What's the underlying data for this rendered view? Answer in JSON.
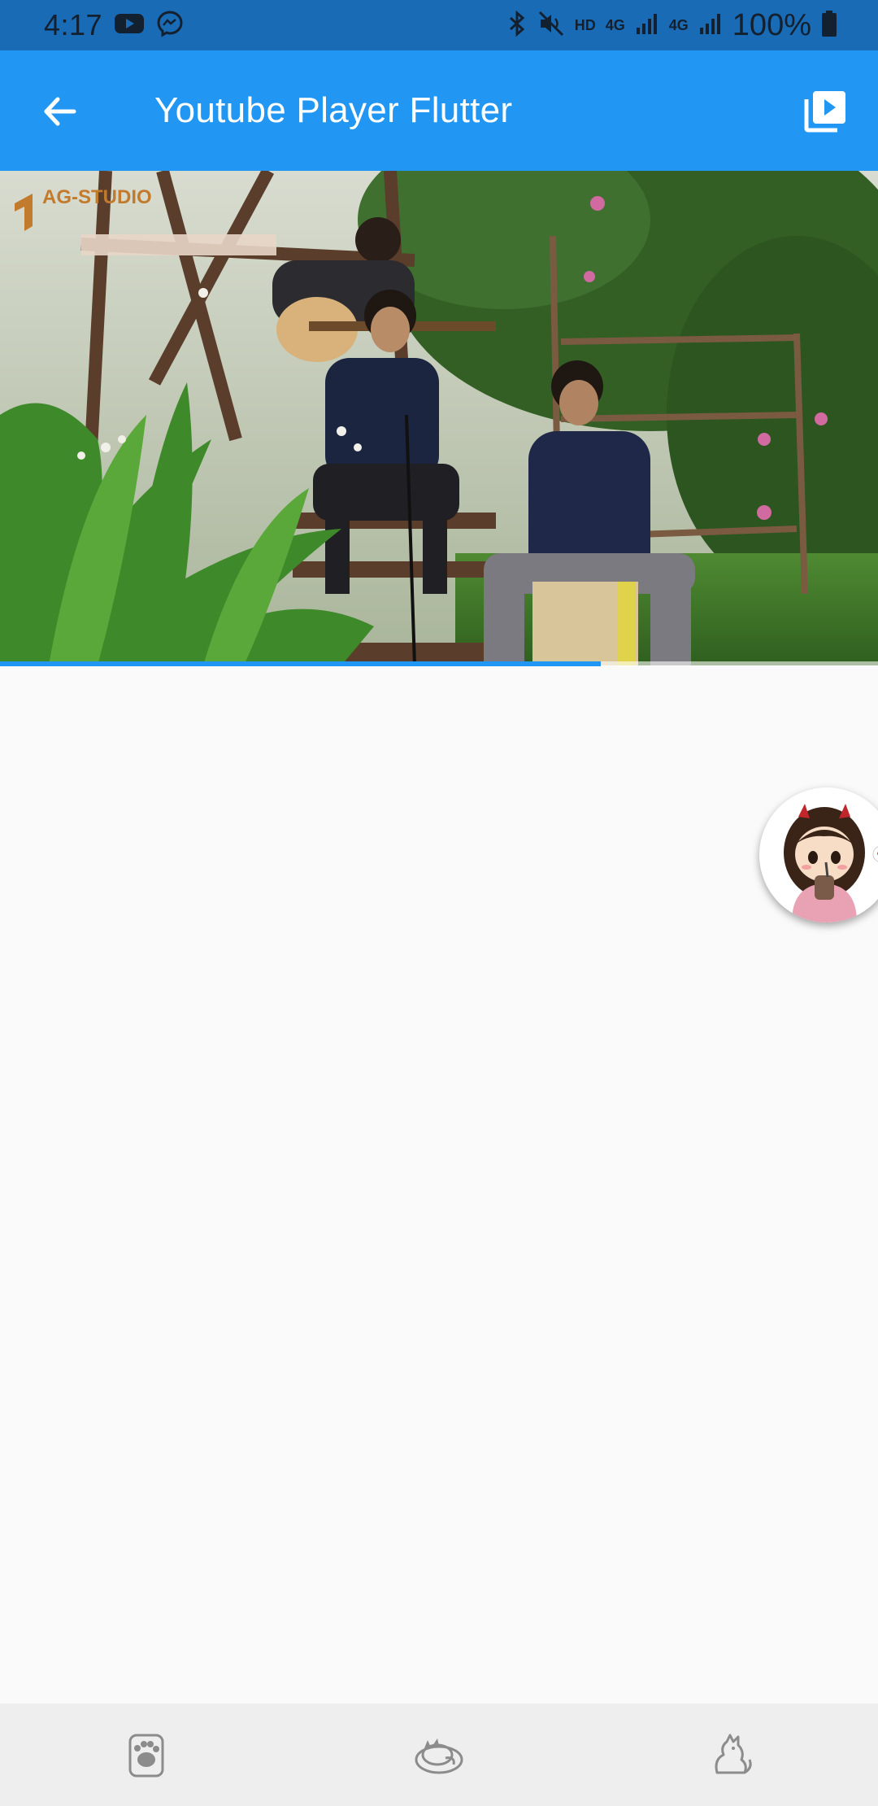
{
  "status_bar": {
    "time": "4:17",
    "network_hd": "HD",
    "network_4g_1": "4G",
    "network_4g_2": "4G",
    "battery": "100%",
    "icons": [
      "youtube-icon",
      "messenger-icon",
      "bluetooth-icon",
      "mute-vibrate-icon",
      "signal-icon",
      "signal-icon",
      "battery-icon"
    ]
  },
  "app_bar": {
    "title": "Youtube Player Flutter",
    "back_icon": "arrow-back-icon",
    "action_icon": "video-library-icon"
  },
  "video": {
    "watermark": "AG-STUDIO",
    "progress": 0.684
  },
  "bottom_nav": {
    "items": [
      {
        "icon": "paw-icon"
      },
      {
        "icon": "sleeping-cat-icon"
      },
      {
        "icon": "cat-icon"
      }
    ]
  },
  "colors": {
    "primary": "#2196f3",
    "status_bar": "#1a6bb5",
    "background": "#fafafa",
    "nav_bar": "#eeeeee"
  }
}
